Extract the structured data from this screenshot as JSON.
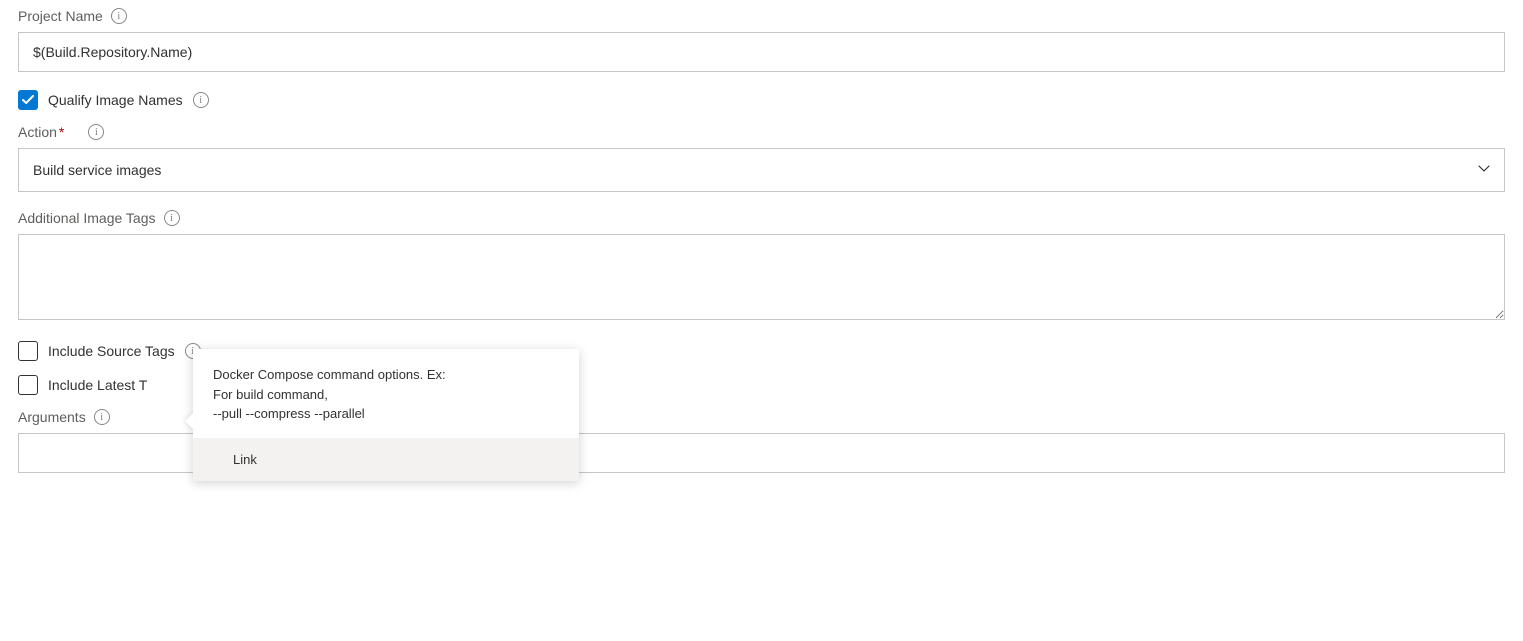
{
  "projectName": {
    "label": "Project Name",
    "value": "$(Build.Repository.Name)"
  },
  "qualifyImageNames": {
    "label": "Qualify Image Names",
    "checked": true
  },
  "action": {
    "label": "Action",
    "required": "*",
    "value": "Build service images"
  },
  "additionalImageTags": {
    "label": "Additional Image Tags",
    "value": ""
  },
  "includeSourceTags": {
    "label": "Include Source Tags",
    "checked": false
  },
  "includeLatestTag": {
    "label": "Include Latest T",
    "checked": false
  },
  "arguments": {
    "label": "Arguments",
    "value": ""
  },
  "tooltip": {
    "line1": "Docker Compose command options. Ex:",
    "line2": "For build command,",
    "line3": "--pull --compress --parallel",
    "link": "Link"
  }
}
